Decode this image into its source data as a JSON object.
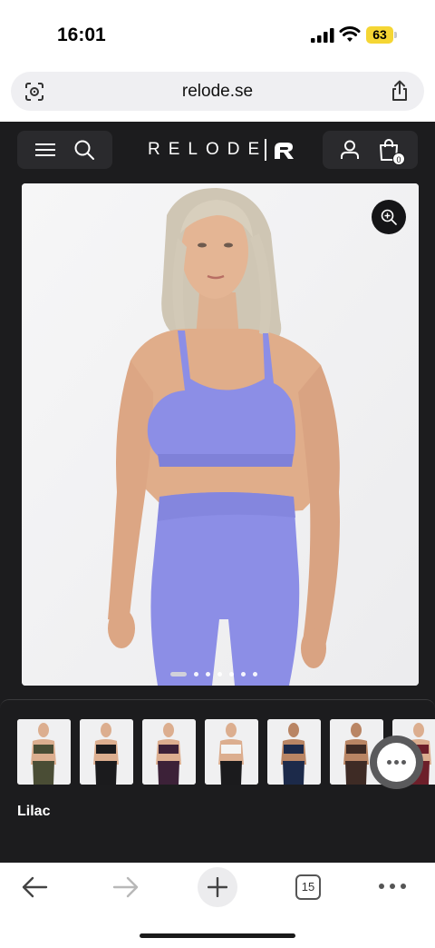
{
  "status_bar": {
    "time": "16:01",
    "battery_level": "63",
    "icons": [
      "signal-icon",
      "wifi-icon",
      "battery-icon"
    ]
  },
  "browser": {
    "url": "relode.se",
    "open_tabs_count": "15",
    "icons": [
      "page-settings-icon",
      "share-icon",
      "back-arrow-icon",
      "forward-arrow-icon",
      "plus-icon",
      "tabs-icon",
      "more-icon"
    ]
  },
  "site": {
    "logo_text": "RELODE",
    "cart_count": "0",
    "selected_color": "Lilac",
    "image_gallery": {
      "image_count": 7,
      "active_index": 0
    },
    "thumbnail_count": 7,
    "icons": [
      "menu-icon",
      "search-icon",
      "account-icon",
      "shopping-bag-icon",
      "zoom-icon",
      "chat-icon"
    ],
    "colors": {
      "background": "#1c1c1e",
      "product": "#8c8ee6"
    }
  }
}
